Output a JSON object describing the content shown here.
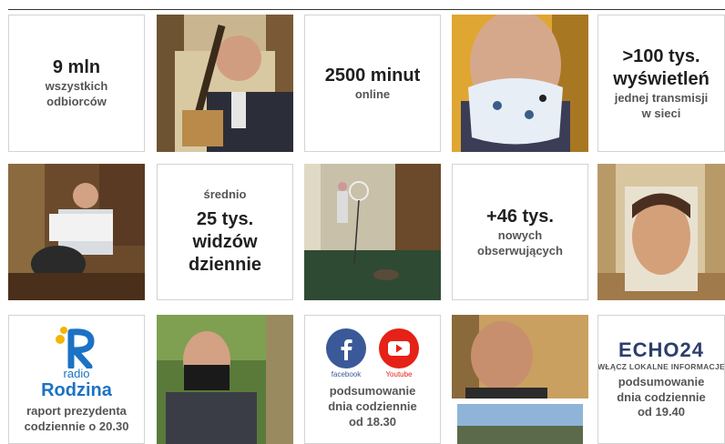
{
  "tiles": {
    "audience": {
      "big": "9 mln",
      "small1": "wszystkich",
      "small2": "odbiorców"
    },
    "minutes": {
      "big": "2500 minut",
      "small1": "online"
    },
    "views": {
      "big1": ">100 tys.",
      "big2": "wyświetleń",
      "small1": "jednej transmisji",
      "small2": "w sieci"
    },
    "daily": {
      "small1": "średnio",
      "big1": "25 tys.",
      "big2": "widzów",
      "big3": "dziennie"
    },
    "followers": {
      "big": "+46 tys.",
      "small1": "nowych",
      "small2": "obserwujących"
    },
    "radio": {
      "radio_word": "radio",
      "brand": "Rodzina",
      "small1": "raport prezydenta",
      "small2": "codziennie o 20.30"
    },
    "social": {
      "facebook_label": "facebook",
      "youtube_label": "Youtube",
      "small1": "podsumowanie",
      "small2": "dnia codziennie",
      "small3": "od 18.30"
    },
    "echo": {
      "brand": "ECHO24",
      "tagline": "WŁĄCZ LOKALNE INFORMACJE",
      "small1": "podsumowanie",
      "small2": "dnia codziennie",
      "small3": "od 19.40"
    }
  },
  "colors": {
    "radio_blue": "#1b72c4",
    "radio_yellow": "#f5b400",
    "facebook_blue": "#3b5998",
    "youtube_red": "#e62117",
    "echo_navy": "#2c3e6b",
    "echo_red": "#e8312f"
  }
}
